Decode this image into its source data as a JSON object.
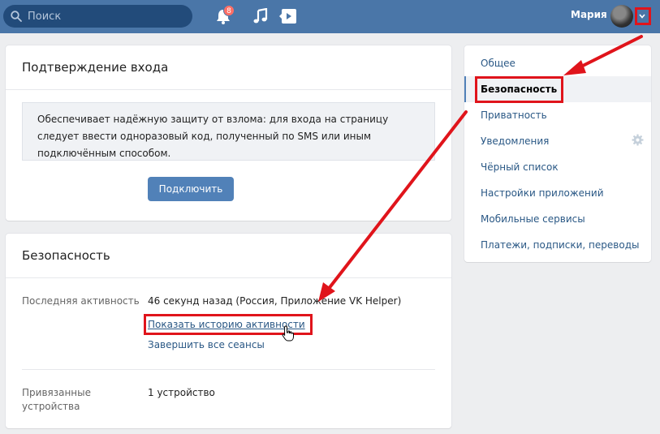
{
  "header": {
    "search_placeholder": "Поиск",
    "notification_count": "8",
    "user_name": "Мария"
  },
  "two_factor": {
    "title": "Подтверждение входа",
    "description": "Обеспечивает надёжную защиту от взлома: для входа на страницу следует ввести одноразовый код, полученный по SMS или иным подключённым способом.",
    "connect_label": "Подключить"
  },
  "security": {
    "title": "Безопасность",
    "last_activity_label": "Последняя активность",
    "last_activity_value": "46 секунд назад (Россия, Приложение VK Helper)",
    "show_history_label": "Показать историю активности",
    "end_sessions_label": "Завершить все сеансы",
    "devices_label": "Привязанные устройства",
    "devices_value": "1 устройство"
  },
  "settings_menu": {
    "items": [
      {
        "label": "Общее"
      },
      {
        "label": "Безопасность"
      },
      {
        "label": "Приватность"
      },
      {
        "label": "Уведомления"
      },
      {
        "label": "Чёрный список"
      },
      {
        "label": "Настройки приложений"
      },
      {
        "label": "Мобильные сервисы"
      },
      {
        "label": "Платежи, подписки, переводы"
      }
    ],
    "active_index": 1
  },
  "colors": {
    "header": "#4a76a8",
    "accent_button": "#5181b8",
    "link": "#2a5885",
    "annotation": "#e0141b"
  },
  "icons": [
    "search-icon",
    "bell-icon",
    "music-icon",
    "video-icon",
    "chevron-down-icon",
    "gear-icon",
    "hand-cursor-icon"
  ]
}
